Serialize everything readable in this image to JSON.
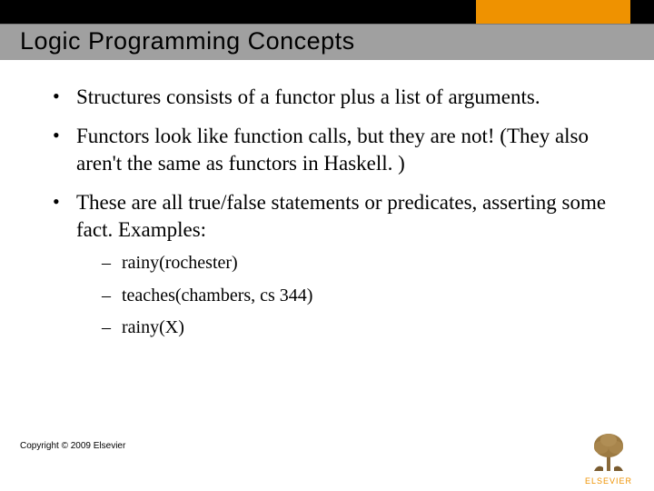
{
  "header": {
    "title": "Logic Programming Concepts"
  },
  "bullets": [
    {
      "text": "Structures consists of a functor plus a list of arguments."
    },
    {
      "text": "Functors look like function calls, but they are not! (They also aren't the same as functors in Haskell. )"
    },
    {
      "text": "These are all true/false statements or predicates, asserting some fact. Examples:"
    }
  ],
  "sub_bullets": [
    {
      "text": "rainy(rochester)"
    },
    {
      "text": "teaches(chambers, cs 344)"
    },
    {
      "text": "rainy(X)"
    }
  ],
  "footer": {
    "copyright": "Copyright © 2009 Elsevier",
    "brand": "ELSEVIER"
  }
}
